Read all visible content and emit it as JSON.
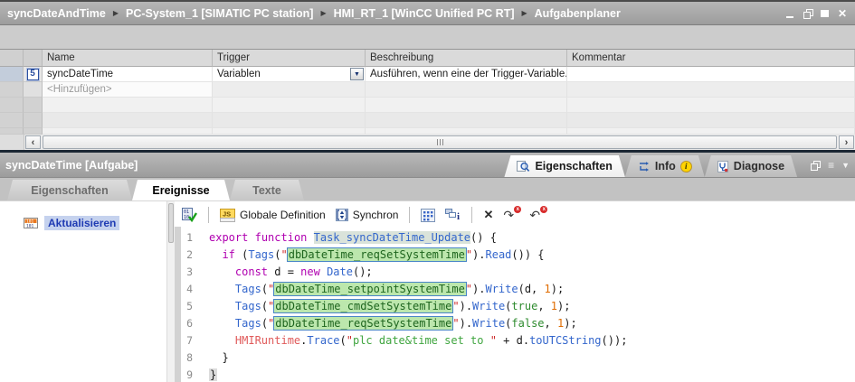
{
  "breadcrumb": {
    "items": [
      "syncDateAndTime",
      "PC-System_1 [SIMATIC PC station]",
      "HMI_RT_1 [WinCC Unified PC RT]",
      "Aufgabenplaner"
    ]
  },
  "glyphs": {
    "crumb_sep": "▶",
    "close": "✕",
    "dropdown": "▼",
    "scroll_left": "‹",
    "scroll_right": "›",
    "list": "≡",
    "chevron_down": "▼",
    "delete_x": "✕",
    "redo_arrow": "↷",
    "undo_arrow": "↶",
    "badge_x": "x"
  },
  "table": {
    "headers": [
      "Name",
      "Trigger",
      "Beschreibung",
      "Kommentar"
    ],
    "rows": [
      {
        "badge": "5",
        "name": "syncDateTime",
        "trigger": "Variablen",
        "description": "Ausführen, wenn eine der Trigger-Variable..",
        "comment": ""
      }
    ],
    "add_row_label": "<Hinzufügen>"
  },
  "inspector": {
    "title": "syncDateTime [Aufgabe]",
    "panes": [
      {
        "label": "Eigenschaften"
      },
      {
        "label": "Info"
      },
      {
        "label": "Diagnose"
      }
    ],
    "info_badge": "i",
    "tabs": [
      {
        "label": "Eigenschaften"
      },
      {
        "label": "Ereignisse"
      },
      {
        "label": "Texte"
      }
    ],
    "active_tab": "Ereignisse"
  },
  "events_panel": {
    "items": [
      {
        "label": "Aktualisieren"
      }
    ]
  },
  "editor": {
    "toolbar": {
      "global_definition_label": "Globale Definition",
      "synchron_label": "Synchron"
    },
    "code": {
      "lines": [
        {
          "n": "1",
          "tokens": [
            {
              "c": "kw",
              "t": "export"
            },
            {
              "c": "pl",
              "t": " "
            },
            {
              "c": "kw",
              "t": "function"
            },
            {
              "c": "pl",
              "t": " "
            },
            {
              "c": "fn",
              "t": "Task_syncDateTime_Update"
            },
            {
              "c": "pl",
              "t": "() {"
            }
          ]
        },
        {
          "n": "2",
          "tokens": [
            {
              "c": "pl",
              "t": "  "
            },
            {
              "c": "kw",
              "t": "if"
            },
            {
              "c": "pl",
              "t": " ("
            },
            {
              "c": "id",
              "t": "Tags"
            },
            {
              "c": "pl",
              "t": "("
            },
            {
              "c": "str",
              "t": "\""
            },
            {
              "c": "tag",
              "t": "dbDateTime_reqSetSystemTime"
            },
            {
              "c": "str",
              "t": "\""
            },
            {
              "c": "pl",
              "t": ")."
            },
            {
              "c": "id",
              "t": "Read"
            },
            {
              "c": "pl",
              "t": "()) {"
            }
          ]
        },
        {
          "n": "3",
          "tokens": [
            {
              "c": "pl",
              "t": "    "
            },
            {
              "c": "kw",
              "t": "const"
            },
            {
              "c": "pl",
              "t": " d = "
            },
            {
              "c": "kw",
              "t": "new"
            },
            {
              "c": "pl",
              "t": " "
            },
            {
              "c": "id",
              "t": "Date"
            },
            {
              "c": "pl",
              "t": "();"
            }
          ]
        },
        {
          "n": "4",
          "tokens": [
            {
              "c": "pl",
              "t": "    "
            },
            {
              "c": "id",
              "t": "Tags"
            },
            {
              "c": "pl",
              "t": "("
            },
            {
              "c": "str",
              "t": "\""
            },
            {
              "c": "tag",
              "t": "dbDateTime_setpointSystemTime"
            },
            {
              "c": "str",
              "t": "\""
            },
            {
              "c": "pl",
              "t": ")."
            },
            {
              "c": "id",
              "t": "Write"
            },
            {
              "c": "pl",
              "t": "(d, "
            },
            {
              "c": "num",
              "t": "1"
            },
            {
              "c": "pl",
              "t": ");"
            }
          ]
        },
        {
          "n": "5",
          "tokens": [
            {
              "c": "pl",
              "t": "    "
            },
            {
              "c": "id",
              "t": "Tags"
            },
            {
              "c": "pl",
              "t": "("
            },
            {
              "c": "str",
              "t": "\""
            },
            {
              "c": "tag",
              "t": "dbDateTime_cmdSetSystemTime"
            },
            {
              "c": "str",
              "t": "\""
            },
            {
              "c": "pl",
              "t": ")."
            },
            {
              "c": "id",
              "t": "Write"
            },
            {
              "c": "pl",
              "t": "("
            },
            {
              "c": "bool",
              "t": "true"
            },
            {
              "c": "pl",
              "t": ", "
            },
            {
              "c": "num",
              "t": "1"
            },
            {
              "c": "pl",
              "t": ");"
            }
          ]
        },
        {
          "n": "6",
          "tokens": [
            {
              "c": "pl",
              "t": "    "
            },
            {
              "c": "id",
              "t": "Tags"
            },
            {
              "c": "pl",
              "t": "("
            },
            {
              "c": "str",
              "t": "\""
            },
            {
              "c": "tag",
              "t": "dbDateTime_reqSetSystemTime"
            },
            {
              "c": "str",
              "t": "\""
            },
            {
              "c": "pl",
              "t": ")."
            },
            {
              "c": "id",
              "t": "Write"
            },
            {
              "c": "pl",
              "t": "("
            },
            {
              "c": "bool",
              "t": "false"
            },
            {
              "c": "pl",
              "t": ", "
            },
            {
              "c": "num",
              "t": "1"
            },
            {
              "c": "pl",
              "t": ");"
            }
          ]
        },
        {
          "n": "7",
          "tokens": [
            {
              "c": "pl",
              "t": "    "
            },
            {
              "c": "hmi",
              "t": "HMIRuntime"
            },
            {
              "c": "pl",
              "t": "."
            },
            {
              "c": "id",
              "t": "Trace"
            },
            {
              "c": "pl",
              "t": "("
            },
            {
              "c": "str",
              "t": "\""
            },
            {
              "c": "strg",
              "t": "plc date&time set to "
            },
            {
              "c": "str",
              "t": "\""
            },
            {
              "c": "pl",
              "t": " + d."
            },
            {
              "c": "id",
              "t": "toUTCString"
            },
            {
              "c": "pl",
              "t": "());"
            }
          ]
        },
        {
          "n": "8",
          "tokens": [
            {
              "c": "pl",
              "t": "  }"
            }
          ]
        },
        {
          "n": "9",
          "tokens": [
            {
              "c": "brhl",
              "t": "}"
            }
          ]
        }
      ]
    }
  },
  "colors": {
    "kw": "#b000b0",
    "ident": "#3366cc",
    "quote": "#cc2a2a",
    "string": "#3fa53f",
    "bool": "#2e8b2e",
    "num": "#e06c00",
    "hmi": "#e05a5a",
    "tag_bg": "#bce7ad",
    "tag_border": "#4a86c8",
    "tag_text": "#1e651e",
    "fn_bg": "#dae3da",
    "selection": "#c5d2ee",
    "event_text": "#1f3bb3"
  }
}
